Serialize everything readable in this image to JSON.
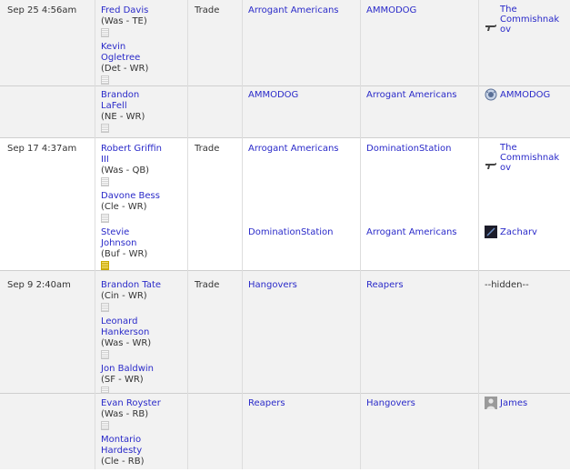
{
  "transactions": [
    {
      "date": "Sep 25 4:56am",
      "type": "Trade",
      "legs": [
        {
          "players": [
            {
              "name_lines": [
                "Fred Davis"
              ],
              "detail": "(Was - TE)",
              "note": "plain"
            },
            {
              "name_lines": [
                "Kevin",
                "Ogletree"
              ],
              "detail": "(Det - WR)",
              "note": "plain"
            }
          ],
          "from": "Arrogant Americans",
          "to": "AMMODOG",
          "owner_lines": [
            "The",
            "Commishnak",
            "ov"
          ],
          "owner_icon": "gun-icon"
        },
        {
          "players": [
            {
              "name_lines": [
                "Brandon",
                "LaFell"
              ],
              "detail": "(NE - WR)",
              "note": "plain"
            }
          ],
          "from": "AMMODOG",
          "to": "Arrogant Americans",
          "owner_lines": [
            "AMMODOG"
          ],
          "owner_icon": "emblem-icon"
        }
      ]
    },
    {
      "date": "Sep 17 4:37am",
      "type": "Trade",
      "legs": [
        {
          "players": [
            {
              "name_lines": [
                "Robert Griffin",
                "III"
              ],
              "detail": "(Was - QB)",
              "note": "plain"
            },
            {
              "name_lines": [
                "Davone Bess"
              ],
              "detail": "(Cle - WR)",
              "note": "plain"
            }
          ],
          "from": "Arrogant Americans",
          "to": "DominationStation",
          "owner_lines": [
            "The",
            "Commishnak",
            "ov"
          ],
          "owner_icon": "gun-icon"
        },
        {
          "players": [
            {
              "name_lines": [
                "Stevie",
                "Johnson"
              ],
              "detail": "(Buf - WR)",
              "note": "yellow"
            }
          ],
          "from": "DominationStation",
          "to": "Arrogant Americans",
          "owner_lines": [
            "Zacharv"
          ],
          "owner_icon": "dark-avatar-icon"
        }
      ]
    },
    {
      "date": "Sep 9 2:40am",
      "type": "Trade",
      "legs": [
        {
          "players": [
            {
              "name_lines": [
                "Brandon Tate"
              ],
              "detail": "(Cin - WR)",
              "note": "plain"
            },
            {
              "name_lines": [
                "Leonard",
                "Hankerson"
              ],
              "detail": "(Was - WR)",
              "note": "plain"
            },
            {
              "name_lines": [
                "Jon Baldwin"
              ],
              "detail": "(SF - WR)",
              "note": "plain"
            }
          ],
          "from": "Hangovers",
          "to": "Reapers",
          "owner_lines": [
            "--hidden--"
          ],
          "owner_icon": ""
        },
        {
          "players": [
            {
              "name_lines": [
                "Evan Royster"
              ],
              "detail": "(Was - RB)",
              "note": "plain"
            },
            {
              "name_lines": [
                "Montario",
                "Hardesty"
              ],
              "detail": "(Cle - RB)",
              "note": "none"
            }
          ],
          "from": "Reapers",
          "to": "Hangovers",
          "owner_lines": [
            "James"
          ],
          "owner_icon": "person-silhouette-icon"
        }
      ]
    }
  ]
}
